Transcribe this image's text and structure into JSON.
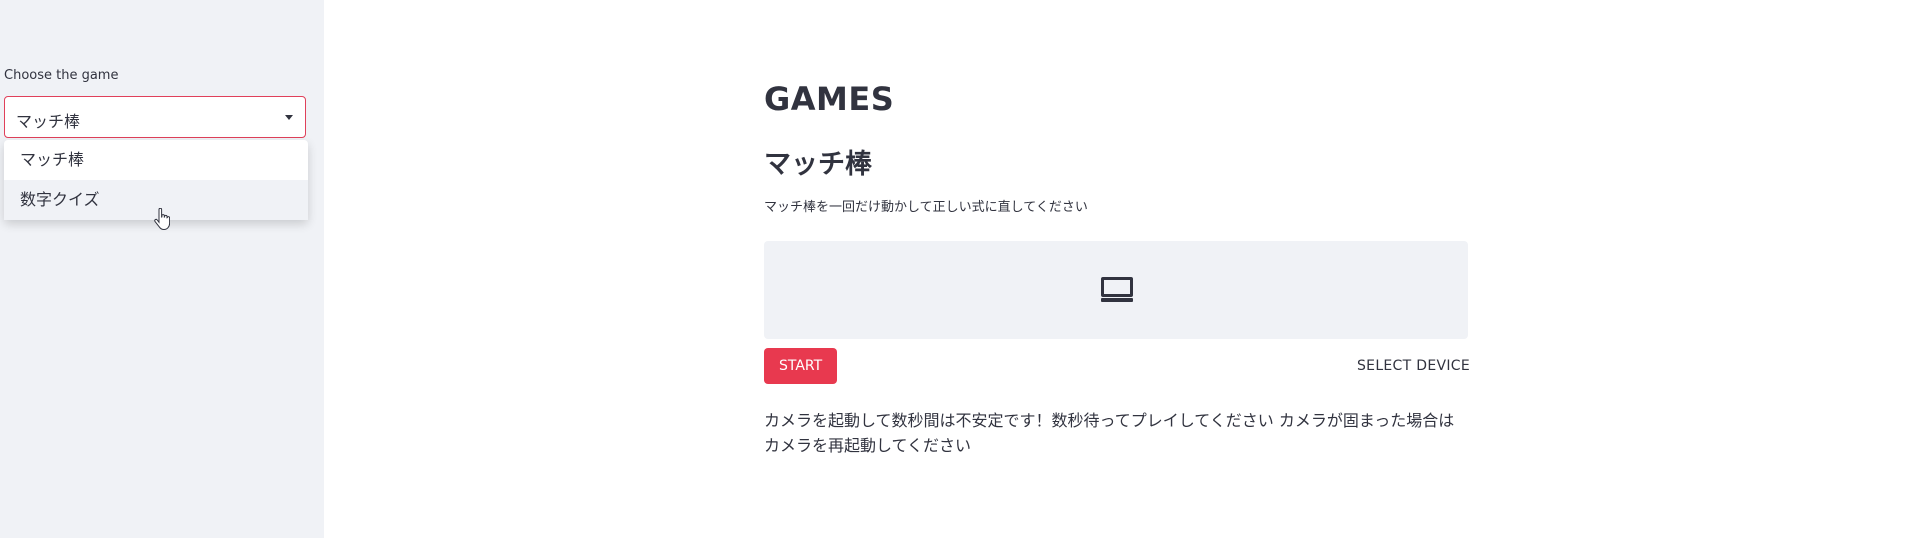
{
  "sidebar": {
    "select": {
      "label": "Choose the game",
      "value": "マッチ棒",
      "options": [
        "マッチ棒",
        "数字クイズ"
      ],
      "hovered_index": 1
    }
  },
  "main": {
    "title": "GAMES",
    "subtitle": "マッチ棒",
    "instructions": "マッチ棒を一回だけ動かして正しい式に直してください",
    "start_label": "START",
    "select_device_label": "SELECT DEVICE",
    "note": "カメラを起動して数秒間は不安定です！数秒待ってプレイしてください カメラが固まった場合はカメラを再起動してください"
  },
  "colors": {
    "accent": "#e8394f",
    "sidebar_bg": "#f0f2f6",
    "text": "#31333f"
  },
  "icons": {
    "chevron": "chevron-down-icon",
    "device": "device-icon",
    "cursor": "pointer-cursor-icon"
  }
}
